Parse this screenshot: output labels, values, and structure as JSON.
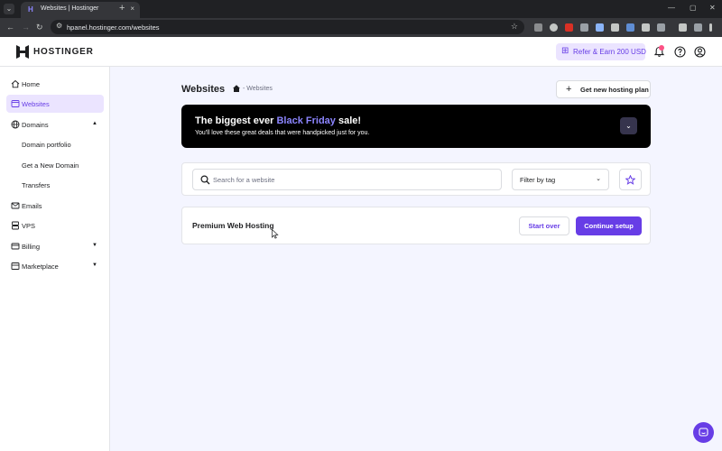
{
  "browser": {
    "tab_title": "Websites | Hostinger",
    "tab_close": "×",
    "new_tab": "+",
    "url": "hpanel.hostinger.com/websites",
    "controls": {
      "minimize": "—",
      "maximize": "▢",
      "close": "✕"
    },
    "nav": {
      "back": "←",
      "forward": "→",
      "reload": "↻"
    }
  },
  "header": {
    "brand": "HOSTINGER",
    "refer_label": "Refer & Earn 200 USD"
  },
  "sidebar": {
    "items": [
      {
        "label": "Home",
        "icon": "home-icon"
      },
      {
        "label": "Websites",
        "icon": "websites-icon",
        "active": true
      },
      {
        "label": "Domains",
        "icon": "globe-icon",
        "expanded": true
      },
      {
        "label": "Domain portfolio"
      },
      {
        "label": "Get a New Domain"
      },
      {
        "label": "Transfers"
      },
      {
        "label": "Emails",
        "icon": "mail-icon"
      },
      {
        "label": "VPS",
        "icon": "server-icon"
      },
      {
        "label": "Billing",
        "icon": "billing-icon"
      },
      {
        "label": "Marketplace",
        "icon": "marketplace-icon"
      }
    ]
  },
  "main": {
    "title": "Websites",
    "breadcrumb": "- Websites",
    "add_plan_label": "Get new hosting plan",
    "banner": {
      "title_pre": "The biggest ever ",
      "title_highlight": "Black Friday",
      "title_post": " sale!",
      "subtitle": "You'll love these great deals that were handpicked just for you."
    },
    "search": {
      "placeholder": "Search for a website",
      "value": ""
    },
    "filter": {
      "label": "Filter by tag"
    },
    "site": {
      "name": "Premium Web Hosting",
      "start_over": "Start over",
      "continue_setup": "Continue setup"
    }
  },
  "colors": {
    "accent": "#673de6",
    "accent_light": "#ebe4ff",
    "highlight": "#8c85ff",
    "notification": "#fc5185"
  }
}
